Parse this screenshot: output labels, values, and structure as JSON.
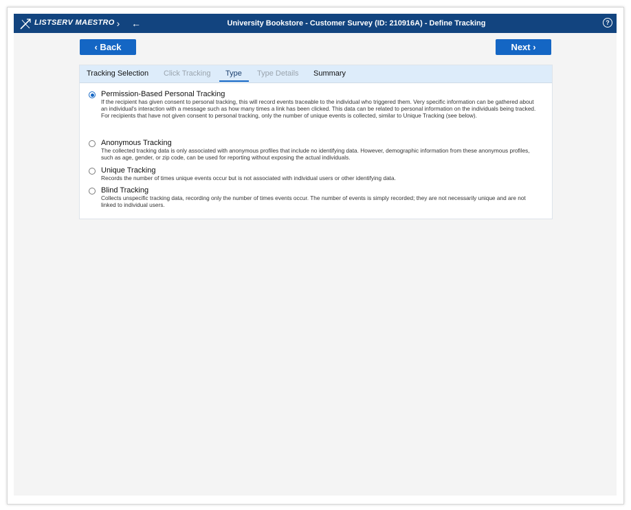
{
  "header": {
    "app_name": "LISTSERV MAESTRO",
    "title": "University Bookstore - Customer Survey (ID: 210916A) - Define Tracking",
    "forward_icon": "›",
    "back_arrow_icon": "←",
    "help_icon": "?"
  },
  "actions": {
    "back_label": "‹ Back",
    "next_label": "Next ›"
  },
  "tabs": [
    {
      "label": "Tracking Selection",
      "state": "done"
    },
    {
      "label": "Click Tracking",
      "state": "disabled"
    },
    {
      "label": "Type",
      "state": "active"
    },
    {
      "label": "Type Details",
      "state": "disabled"
    },
    {
      "label": "Summary",
      "state": "done"
    }
  ],
  "options": [
    {
      "title": "Permission-Based Personal Tracking",
      "selected": true,
      "desc": [
        "If the recipient has given consent to personal tracking, this will record events traceable to the individual who triggered them. Very specific information can be gathered about an individual's interaction with a message such as how many times a link has been clicked. This data can be related to personal information on the individuals being tracked.",
        "For recipients that have not given consent to personal tracking, only the number of unique events is collected, similar to Unique Tracking (see below)."
      ]
    },
    {
      "title": "Anonymous Tracking",
      "selected": false,
      "desc": [
        "The collected tracking data is only associated with anonymous profiles that include no identifying data. However, demographic information from these anonymous profiles, such as age, gender, or zip code, can be used for reporting without exposing the actual individuals."
      ]
    },
    {
      "title": "Unique Tracking",
      "selected": false,
      "desc": [
        "Records the number of times unique events occur but is not associated with individual users or other identifying data."
      ]
    },
    {
      "title": "Blind Tracking",
      "selected": false,
      "desc": [
        "Collects unspecific tracking data, recording only the number of times events occur. The number of events is simply recorded; they are not necessarily unique and are not linked to individual users."
      ]
    }
  ],
  "colors": {
    "header_bg": "#12447f",
    "button_bg": "#1466c4",
    "tab_bar_bg": "#ddecfa"
  }
}
